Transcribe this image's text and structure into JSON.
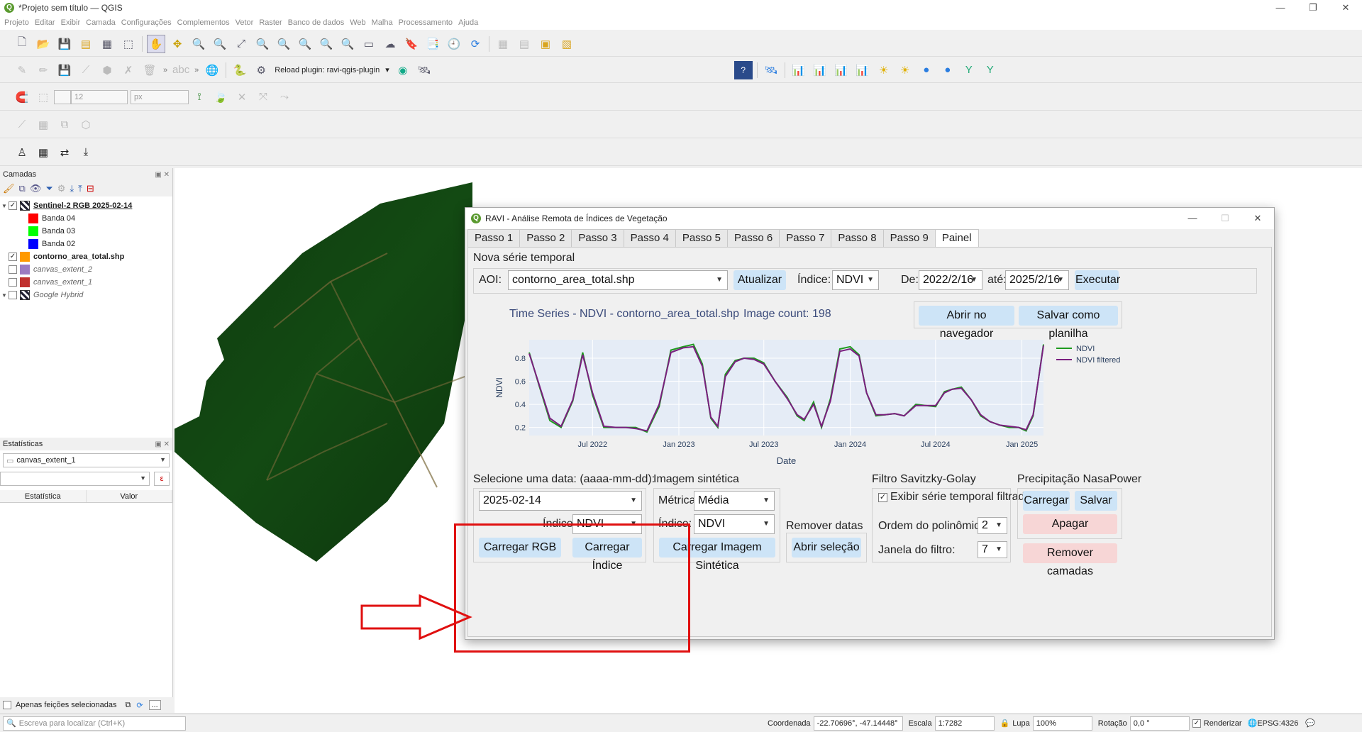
{
  "window": {
    "title": "*Projeto sem título — QGIS"
  },
  "menu": [
    "Projeto",
    "Editar",
    "Exibir",
    "Camada",
    "Configurações",
    "Complementos",
    "Vetor",
    "Raster",
    "Banco de dados",
    "Web",
    "Malha",
    "Processamento",
    "Ajuda"
  ],
  "plugins_toolbar": {
    "reload_label": "Reload plugin: ravi-qgis-plugin"
  },
  "snapping_toolbar": {
    "tolerance": "12",
    "unit": "px"
  },
  "layers_panel": {
    "title": "Camadas",
    "layers": [
      {
        "name": "Sentinel-2 RGB 2025-02-14",
        "checked": true
      },
      {
        "name": "Banda 04",
        "color": "#ff0000"
      },
      {
        "name": "Banda 03",
        "color": "#00ff00"
      },
      {
        "name": "Banda 02",
        "color": "#0000ff"
      },
      {
        "name": "contorno_area_total.shp",
        "checked": true,
        "color": "#ff9900"
      },
      {
        "name": "canvas_extent_2",
        "checked": false,
        "color": "#9b7bc1"
      },
      {
        "name": "canvas_extent_1",
        "checked": false,
        "color": "#c0302e"
      },
      {
        "name": "Google Hybrid",
        "checked": false
      }
    ]
  },
  "stats_panel": {
    "title": "Estatísticas",
    "layer": "canvas_extent_1",
    "field": "",
    "columns": [
      "Estatística",
      "Valor"
    ],
    "expr_button": "ε"
  },
  "bottom_left": {
    "selected_only": "Apenas feições selecionadas",
    "more": "..."
  },
  "statusbar": {
    "locator_placeholder": "Escreva para localizar (Ctrl+K)",
    "coord_label": "Coordenada",
    "coord_value": "-22.70696°, -47.14448°",
    "scale_label": "Escala",
    "scale_value": "1:7282",
    "zoom_label": "Lupa",
    "zoom_value": "100%",
    "rotation_label": "Rotação",
    "rotation_value": "0,0 °",
    "render_label": "Renderizar",
    "crs": "EPSG:4326"
  },
  "dialog": {
    "title": "RAVI - Análise Remota de Índices de Vegetação",
    "tabs": [
      "Passo 1",
      "Passo 2",
      "Passo 3",
      "Passo 4",
      "Passo 5",
      "Passo 6",
      "Passo 7",
      "Passo 8",
      "Passo 9",
      "Painel"
    ],
    "active_tab": "Painel",
    "nova_serie": "Nova série temporal",
    "aoi_label": "AOI:",
    "aoi_value": "contorno_area_total.shp",
    "atualizar": "Atualizar",
    "indice_label": "Índice:",
    "indice_value": "NDVI",
    "de_label": "De:",
    "de_value": "2022/2/16",
    "ate_label": "até:",
    "ate_value": "2025/2/16",
    "executar": "Executar",
    "chart_title": "Time Series - NDVI - contorno_area_total.shp",
    "image_count": "Image count: 198",
    "abrir_navegador": "Abrir no navegador",
    "salvar_planilha": "Salvar como planilha",
    "selecione_data": "Selecione uma data: (aaaa-mm-dd):",
    "data_value": "2025-02-14",
    "indice2_label": "Índice:",
    "indice2_value": "NDVI",
    "carregar_rgb": "Carregar RGB",
    "carregar_indice": "Carregar Índice",
    "imagem_sintetica": "Imagem sintética",
    "metrica_label": "Métrica:",
    "metrica_value": "Média",
    "indice3_label": "Índice:",
    "indice3_value": "NDVI",
    "carregar_sintetica": "Carregar Imagem Sintética",
    "remover_datas": "Remover datas",
    "abrir_selecao": "Abrir seleção",
    "filtro_title": "Filtro Savitzky-Golay",
    "exibir_filtrada": "Exibir série temporal filtrada",
    "ordem_label": "Ordem do polinômio:",
    "ordem_value": "2",
    "janela_label": "Janela do filtro:",
    "janela_value": "7",
    "precip_title": "Precipitação NasaPower",
    "carregar": "Carregar",
    "salvar": "Salvar",
    "apagar": "Apagar",
    "remover_camadas": "Remover camadas"
  },
  "chart_data": {
    "type": "line",
    "xlabel": "Date",
    "ylabel": "NDVI",
    "x_ticks": [
      "Jul 2022",
      "Jan 2023",
      "Jul 2023",
      "Jan 2024",
      "Jul 2024",
      "Jan 2025"
    ],
    "y_ticks": [
      0.2,
      0.4,
      0.6,
      0.8
    ],
    "ylim": [
      0.13,
      0.96
    ],
    "xlim": [
      "2022-02-16",
      "2025-02-16"
    ],
    "series": [
      {
        "name": "NDVI",
        "color": "#1e9a1e",
        "x": [
          "2022-02-16",
          "2022-03-10",
          "2022-04-01",
          "2022-04-25",
          "2022-05-20",
          "2022-06-10",
          "2022-07-01",
          "2022-07-25",
          "2022-08-20",
          "2022-09-10",
          "2022-10-01",
          "2022-10-25",
          "2022-11-20",
          "2022-12-15",
          "2023-01-10",
          "2023-02-01",
          "2023-02-20",
          "2023-03-10",
          "2023-03-25",
          "2023-04-10",
          "2023-05-01",
          "2023-05-20",
          "2023-06-10",
          "2023-07-01",
          "2023-07-25",
          "2023-08-20",
          "2023-09-10",
          "2023-09-25",
          "2023-10-15",
          "2023-11-01",
          "2023-11-20",
          "2023-12-10",
          "2024-01-01",
          "2024-01-20",
          "2024-02-05",
          "2024-02-25",
          "2024-03-15",
          "2024-04-05",
          "2024-04-25",
          "2024-05-20",
          "2024-06-10",
          "2024-07-01",
          "2024-07-20",
          "2024-08-05",
          "2024-08-25",
          "2024-09-15",
          "2024-10-05",
          "2024-10-25",
          "2024-11-15",
          "2024-12-05",
          "2024-12-25",
          "2025-01-10",
          "2025-01-25",
          "2025-02-16"
        ],
        "values": [
          0.85,
          0.55,
          0.26,
          0.2,
          0.43,
          0.85,
          0.48,
          0.2,
          0.2,
          0.2,
          0.2,
          0.16,
          0.38,
          0.87,
          0.9,
          0.92,
          0.75,
          0.28,
          0.2,
          0.66,
          0.78,
          0.8,
          0.8,
          0.76,
          0.6,
          0.46,
          0.3,
          0.26,
          0.42,
          0.2,
          0.45,
          0.88,
          0.9,
          0.83,
          0.5,
          0.3,
          0.31,
          0.32,
          0.3,
          0.4,
          0.39,
          0.38,
          0.51,
          0.53,
          0.55,
          0.44,
          0.3,
          0.25,
          0.22,
          0.2,
          0.2,
          0.17,
          0.3,
          0.92
        ]
      },
      {
        "name": "NDVI filtered",
        "color": "#7a1f7f",
        "x": [
          "2022-02-16",
          "2022-03-10",
          "2022-04-01",
          "2022-04-25",
          "2022-05-20",
          "2022-06-10",
          "2022-07-01",
          "2022-07-25",
          "2022-08-20",
          "2022-09-10",
          "2022-10-01",
          "2022-10-25",
          "2022-11-20",
          "2022-12-15",
          "2023-01-10",
          "2023-02-01",
          "2023-02-20",
          "2023-03-10",
          "2023-03-25",
          "2023-04-10",
          "2023-05-01",
          "2023-05-20",
          "2023-06-10",
          "2023-07-01",
          "2023-07-25",
          "2023-08-20",
          "2023-09-10",
          "2023-09-25",
          "2023-10-15",
          "2023-11-01",
          "2023-11-20",
          "2023-12-10",
          "2024-01-01",
          "2024-01-20",
          "2024-02-05",
          "2024-02-25",
          "2024-03-15",
          "2024-04-05",
          "2024-04-25",
          "2024-05-20",
          "2024-06-10",
          "2024-07-01",
          "2024-07-20",
          "2024-08-05",
          "2024-08-25",
          "2024-09-15",
          "2024-10-05",
          "2024-10-25",
          "2024-11-15",
          "2024-12-05",
          "2024-12-25",
          "2025-01-10",
          "2025-01-25",
          "2025-02-16"
        ],
        "values": [
          0.84,
          0.56,
          0.28,
          0.21,
          0.44,
          0.83,
          0.5,
          0.21,
          0.2,
          0.2,
          0.19,
          0.17,
          0.4,
          0.85,
          0.89,
          0.9,
          0.73,
          0.29,
          0.21,
          0.64,
          0.77,
          0.8,
          0.79,
          0.75,
          0.6,
          0.45,
          0.31,
          0.27,
          0.4,
          0.21,
          0.43,
          0.86,
          0.88,
          0.82,
          0.5,
          0.31,
          0.31,
          0.32,
          0.3,
          0.39,
          0.39,
          0.39,
          0.5,
          0.53,
          0.54,
          0.44,
          0.31,
          0.25,
          0.22,
          0.21,
          0.2,
          0.18,
          0.31,
          0.91
        ]
      }
    ]
  }
}
